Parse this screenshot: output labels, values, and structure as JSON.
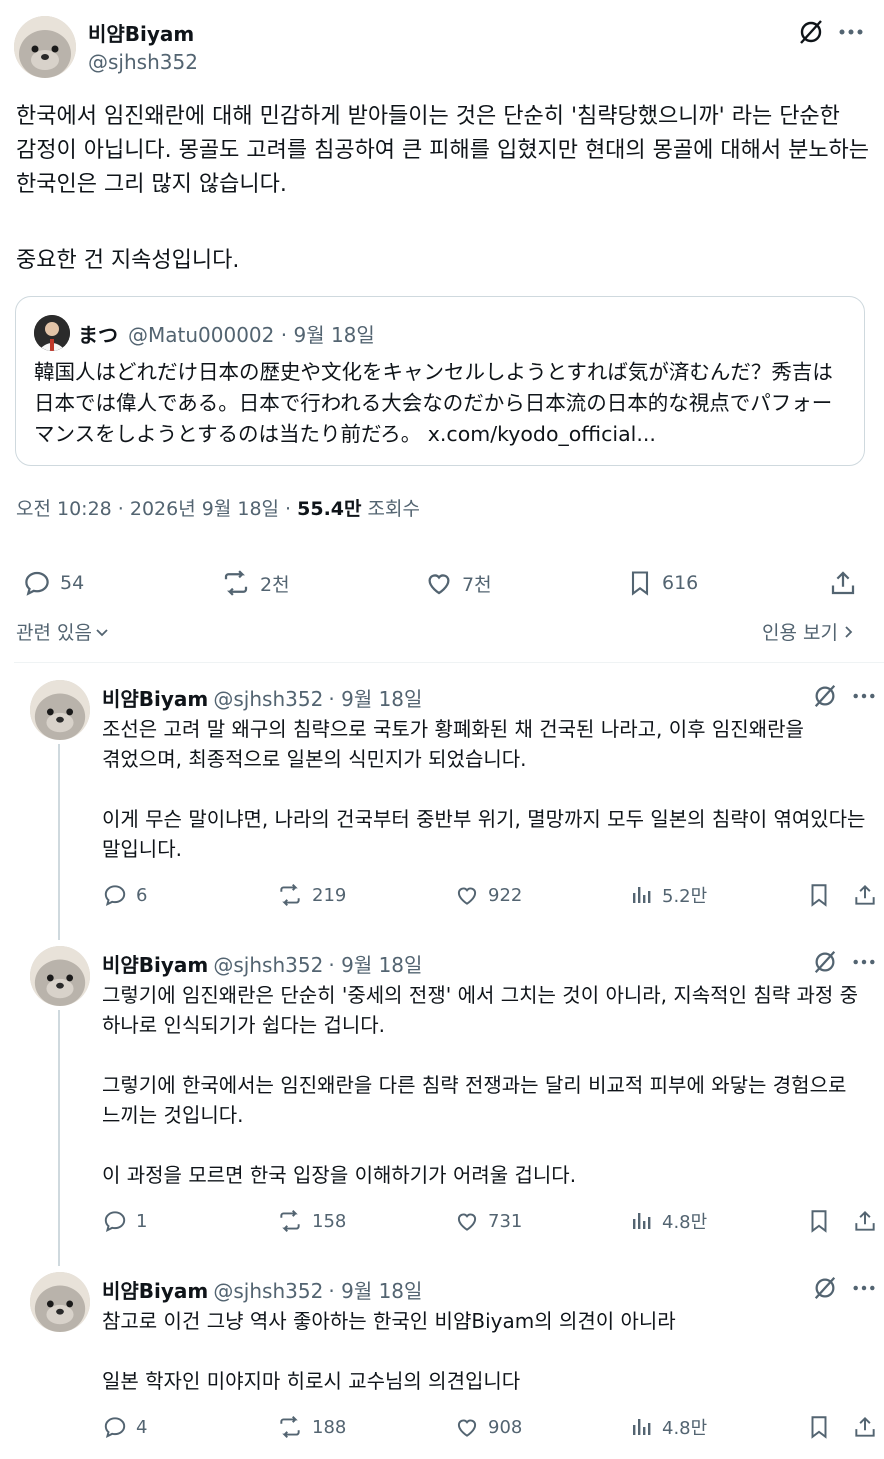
{
  "main_tweet": {
    "author_name": "비얌Biyam",
    "author_handle": "@sjhsh352",
    "text_p1": "한국에서 임진왜란에 대해 민감하게 받아들이는 것은 단순히 '침략당했으니까' 라는 단순한 감정이 아닙니다. 몽골도 고려를 침공하여 큰 피해를 입혔지만 현대의 몽골에 대해서 분노하는 한국인은 그리 많지 않습니다.",
    "text_p2": "중요한 건 지속성입니다.",
    "quote": {
      "author_name": "まつ",
      "author_handle": "@Matu000002",
      "date": "· 9월 18일",
      "text": "韓国人はどれだけ日本の歴史や文化をキャンセルしようとすれば気が済むんだ？秀吉は日本では偉人である。日本で行われる大会なのだから日本流の日本的な視点でパフォーマンスをしようとするのは当たり前だろ。",
      "link": "x.com/kyodo_official..."
    },
    "meta_time": "오전 10:28 · 2026년 9월 18일 · ",
    "meta_views_count": "55.4만",
    "meta_views_label": " 조회수",
    "stats": {
      "replies": "54",
      "retweets": "2천",
      "likes": "7천",
      "bookmarks": "616"
    },
    "related_label": "관련 있음",
    "quotes_label": "인용 보기"
  },
  "replies": [
    {
      "author_name": "비얌Biyam",
      "author_handle": "@sjhsh352",
      "date": "· 9월 18일",
      "paragraphs": [
        "조선은 고려 말 왜구의 침략으로 국토가 황폐화된 채 건국된 나라고, 이후 임진왜란을 겪었으며, 최종적으로 일본의 식민지가 되었습니다.",
        "이게 무슨 말이냐면, 나라의 건국부터 중반부 위기, 멸망까지 모두 일본의 침략이 엮여있다는 말입니다."
      ],
      "stats": {
        "replies": "6",
        "retweets": "219",
        "likes": "922",
        "views": "5.2만"
      }
    },
    {
      "author_name": "비얌Biyam",
      "author_handle": "@sjhsh352",
      "date": "· 9월 18일",
      "paragraphs": [
        "그렇기에 임진왜란은 단순히 '중세의 전쟁' 에서 그치는 것이 아니라, 지속적인 침략 과정 중 하나로 인식되기가 쉽다는 겁니다.",
        "그렇기에 한국에서는 임진왜란을 다른 침략 전쟁과는 달리 비교적 피부에 와닿는 경험으로 느끼는 것입니다.",
        "이 과정을 모르면 한국 입장을 이해하기가 어려울 겁니다."
      ],
      "stats": {
        "replies": "1",
        "retweets": "158",
        "likes": "731",
        "views": "4.8만"
      }
    },
    {
      "author_name": "비얌Biyam",
      "author_handle": "@sjhsh352",
      "date": "· 9월 18일",
      "paragraphs": [
        "참고로 이건 그냥 역사 좋아하는 한국인 비얌Biyam의 의견이 아니라",
        "일본 학자인 미야지마 히로시 교수님의 의견입니다"
      ],
      "stats": {
        "replies": "4",
        "retweets": "188",
        "likes": "908",
        "views": "4.8만"
      }
    }
  ],
  "colors": {
    "text": "#0f1419",
    "muted": "#536471",
    "border": "#cfd9de",
    "divider": "#eff3f4"
  },
  "icons": [
    "grok-icon",
    "more-icon",
    "reply-icon",
    "retweet-icon",
    "like-icon",
    "bookmark-icon",
    "share-icon",
    "views-icon",
    "chevron-down-icon",
    "chevron-right-icon"
  ]
}
